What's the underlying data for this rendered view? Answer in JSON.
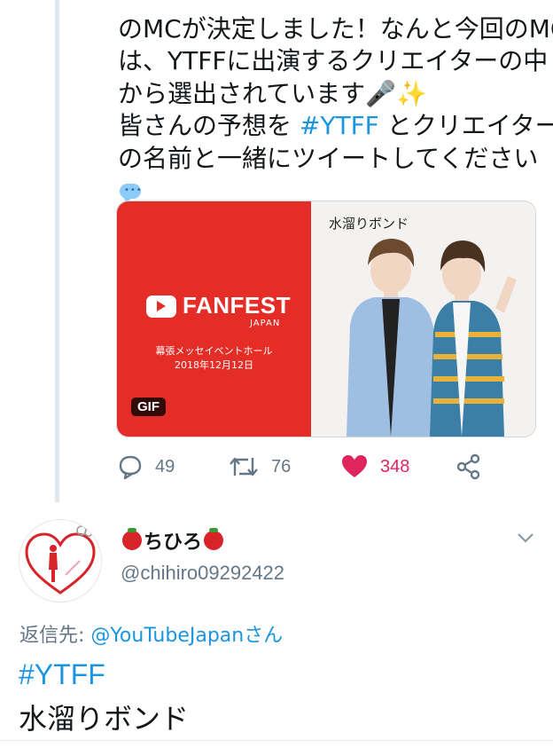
{
  "tweet1": {
    "lines": [
      "",
      "のMCが決定しました！なんと今回のMC",
      "は、YTFFに出演するクリエイターの中",
      "から選出されています🎤✨"
    ],
    "line5_prefix": "皆さんの予想を ",
    "line5_hashtag": "#YTFF",
    "line5_suffix": " とクリエイター",
    "line6": "の名前と一緒にツイートしてください",
    "card": {
      "fanfest_text": "FANFEST",
      "japan_text": "JAPAN",
      "venue": "幕張メッセイベントホール",
      "date": "2018年12月12日",
      "gif_badge": "GIF",
      "name": "水溜りボンド",
      "brand_color": "#e52d27"
    },
    "actions": {
      "replies": "49",
      "retweets": "76",
      "likes": "348"
    }
  },
  "tweet2": {
    "name": "ちひろ",
    "handle": "@chihiro09292422",
    "reply_prefix": "返信先: ",
    "reply_mention": "@YouTubeJapanさん",
    "hashtag": "#YTFF",
    "body": "水溜りボンド"
  },
  "colors": {
    "accent": "#1b95e0",
    "like": "#e0245e",
    "muted": "#657786"
  }
}
